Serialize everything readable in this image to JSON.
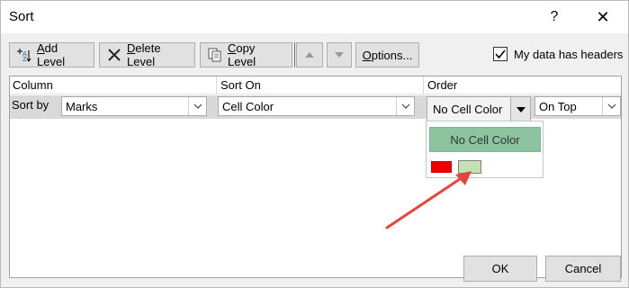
{
  "window": {
    "title": "Sort",
    "help_glyph": "?",
    "close_glyph": "✕"
  },
  "toolbar": {
    "add_level_access": "A",
    "add_level_rest": "dd Level",
    "delete_level_access": "D",
    "delete_level_rest": "elete Level",
    "copy_level_access": "C",
    "copy_level_rest": "opy Level",
    "options_access": "O",
    "options_rest": "ptions..."
  },
  "headers_checkbox": {
    "label": "My data has headers",
    "checked": true
  },
  "grid": {
    "column_header": "Column",
    "sort_on_header": "Sort On",
    "order_header": "Order",
    "rows": [
      {
        "label": "Sort by",
        "column": "Marks",
        "sort_on": "Cell Color",
        "order_value": "No Cell Color",
        "position": "On Top"
      }
    ]
  },
  "color_dropdown": {
    "option_no_color": "No Cell Color",
    "swatches": [
      "#EE0000",
      "#C6E0B4"
    ]
  },
  "footer": {
    "ok": "OK",
    "cancel": "Cancel"
  },
  "colors": {
    "no_color_highlight": "#8CC4A0",
    "annotation_arrow": "#E0463B"
  }
}
